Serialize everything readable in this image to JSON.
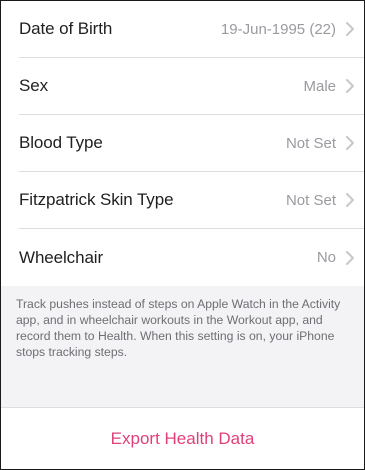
{
  "settings": {
    "rows": [
      {
        "label": "Date of Birth",
        "value": "19-Jun-1995 (22)"
      },
      {
        "label": "Sex",
        "value": "Male"
      },
      {
        "label": "Blood Type",
        "value": "Not Set"
      },
      {
        "label": "Fitzpatrick Skin Type",
        "value": "Not Set"
      },
      {
        "label": "Wheelchair",
        "value": "No"
      }
    ],
    "footnote": "Track pushes instead of steps on Apple Watch in the Activity app, and in wheelchair workouts in the Workout app, and record them to Health. When this setting is on, your iPhone stops tracking steps.",
    "export_label": "Export Health Data"
  },
  "colors": {
    "accent": "#e0407a",
    "value_text": "#9a9aa0",
    "separator": "#dddde1",
    "group_background": "#f3f3f6"
  },
  "icons": {
    "row_disclosure": "chevron-right-icon"
  }
}
